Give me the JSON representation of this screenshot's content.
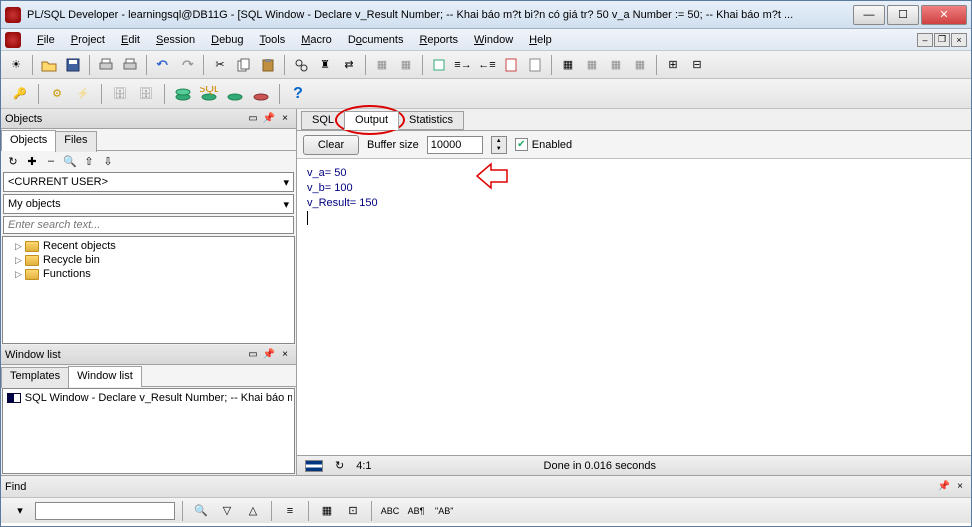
{
  "title": "PL/SQL Developer - learningsql@DB11G - [SQL Window - Declare v_Result Number; -- Khai báo m?t bi?n có giá tr? 50 v_a Number := 50; -- Khai báo m?t ...",
  "menu": [
    "File",
    "Project",
    "Edit",
    "Session",
    "Debug",
    "Tools",
    "Macro",
    "Documents",
    "Reports",
    "Window",
    "Help"
  ],
  "left": {
    "objects_hdr": "Objects",
    "tab_objects": "Objects",
    "tab_files": "Files",
    "current_user": "<CURRENT USER>",
    "my_objects": "My objects",
    "search_placeholder": "Enter search text...",
    "tree": [
      "Recent objects",
      "Recycle bin",
      "Functions"
    ],
    "winlist_hdr": "Window list",
    "tab_templates": "Templates",
    "tab_winlist": "Window list",
    "winlist_item": "SQL Window - Declare v_Result Number; -- Khai báo m"
  },
  "right": {
    "tab_sql": "SQL",
    "tab_output": "Output",
    "tab_stats": "Statistics",
    "clear": "Clear",
    "buffer_label": "Buffer size",
    "buffer_value": "10000",
    "enabled": "Enabled",
    "output_text": "v_a= 50\nv_b= 100\nv_Result= 150",
    "status_ratio": "4:1",
    "status_time": "Done in 0.016 seconds"
  },
  "find": {
    "label": "Find",
    "ab_btn": "\"AB\""
  }
}
